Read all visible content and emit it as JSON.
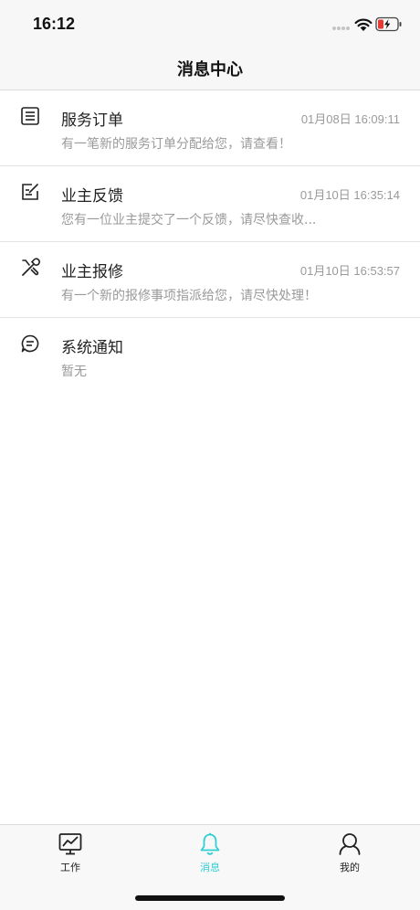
{
  "status_bar": {
    "time": "16:12",
    "icons": [
      "signal-dots-icon",
      "wifi-icon",
      "battery-charging-icon"
    ],
    "battery_color": "#e53935"
  },
  "header": {
    "title": "消息中心"
  },
  "messages": [
    {
      "icon": "order-list-icon",
      "title": "服务订单",
      "time": "01月08日 16:09:11",
      "preview": "有一笔新的服务订单分配给您，请查看！"
    },
    {
      "icon": "edit-note-icon",
      "title": "业主反馈",
      "time": "01月10日 16:35:14",
      "preview": "您有一位业主提交了一个反馈，请尽快查收..."
    },
    {
      "icon": "repair-tools-icon",
      "title": "业主报修",
      "time": "01月10日 16:53:57",
      "preview": "有一个新的报修事项指派给您，请尽快处理！"
    },
    {
      "icon": "chat-bubble-icon",
      "title": "系统通知",
      "time": "",
      "preview": "暂无"
    }
  ],
  "tabs": [
    {
      "icon": "chart-monitor-icon",
      "label": "工作",
      "active": false
    },
    {
      "icon": "bell-icon",
      "label": "消息",
      "active": true
    },
    {
      "icon": "user-icon",
      "label": "我的",
      "active": false
    }
  ],
  "colors": {
    "accent": "#2fcfd3",
    "text": "#222222",
    "muted": "#9a9a9a"
  }
}
